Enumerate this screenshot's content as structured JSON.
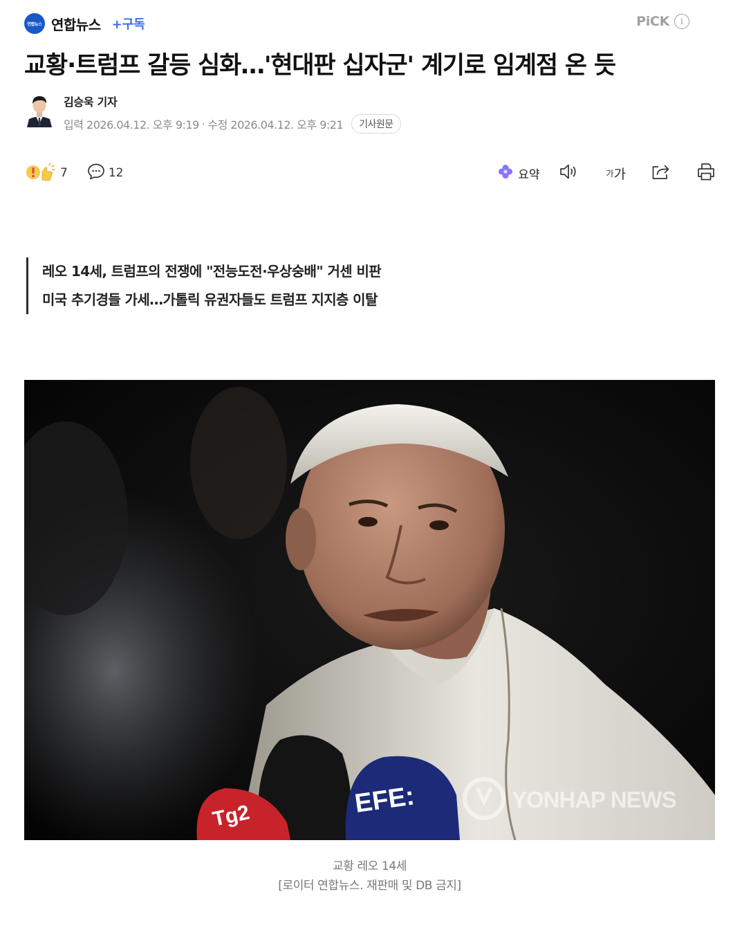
{
  "press": {
    "logo_text": "연합뉴스",
    "name": "연합뉴스",
    "subscribe_label": "+구독",
    "pick_label": "PiCK",
    "info_icon": "info-icon",
    "brand_color": "#1a57c9"
  },
  "article": {
    "headline": "교황·트럼프 갈등 심화…'현대판 십자군' 계기로 임계점 온 듯",
    "reporter": "김승욱 기자",
    "input_date": "입력 2026.04.12. 오후 9:19",
    "edit_date": "수정 2026.04.12. 오후 9:21",
    "date_separator": "·",
    "original_button": "기사원문",
    "subheads": [
      "레오 14세, 트럼프의 전쟁에 \"전능도전·우상숭배\" 거센 비판",
      "미국 추기경들 가세…가톨릭 유권자들도 트럼프 지지층 이탈"
    ],
    "caption_line1": "교황 레오 14세",
    "caption_line2": "[로이터 연합뉴스. 재판매 및 DB 금지]"
  },
  "actions": {
    "reaction_count": "7",
    "comment_count": "12",
    "summary_label": "요약",
    "font_small": "가",
    "font_large": "가",
    "icons": [
      "reaction-emoji-icon",
      "comment-bubble-icon",
      "ai-summary-icon",
      "speaker-icon",
      "share-icon",
      "print-icon"
    ]
  },
  "photo": {
    "watermark": "YONHAP NEWS",
    "mic_labels": [
      "Tg2",
      "EFE:"
    ]
  }
}
